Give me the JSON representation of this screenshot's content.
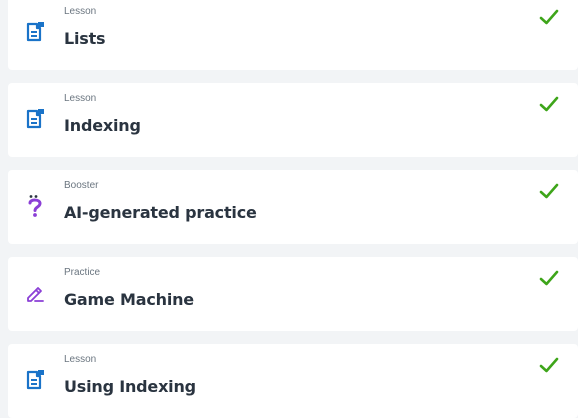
{
  "colors": {
    "lesson_icon": "#1a73c8",
    "practice_icon": "#8b3fd6",
    "check": "#3ea51a",
    "title": "#2a3440",
    "type": "#6b7680"
  },
  "items": [
    {
      "type": "Lesson",
      "title": "Lists",
      "icon": "lesson-icon",
      "completed": true
    },
    {
      "type": "Lesson",
      "title": "Indexing",
      "icon": "lesson-icon",
      "completed": true
    },
    {
      "type": "Booster",
      "title": "AI-generated practice",
      "icon": "question-icon",
      "completed": true
    },
    {
      "type": "Practice",
      "title": "Game Machine",
      "icon": "pencil-icon",
      "completed": true
    },
    {
      "type": "Lesson",
      "title": "Using Indexing",
      "icon": "lesson-icon",
      "completed": true
    }
  ]
}
